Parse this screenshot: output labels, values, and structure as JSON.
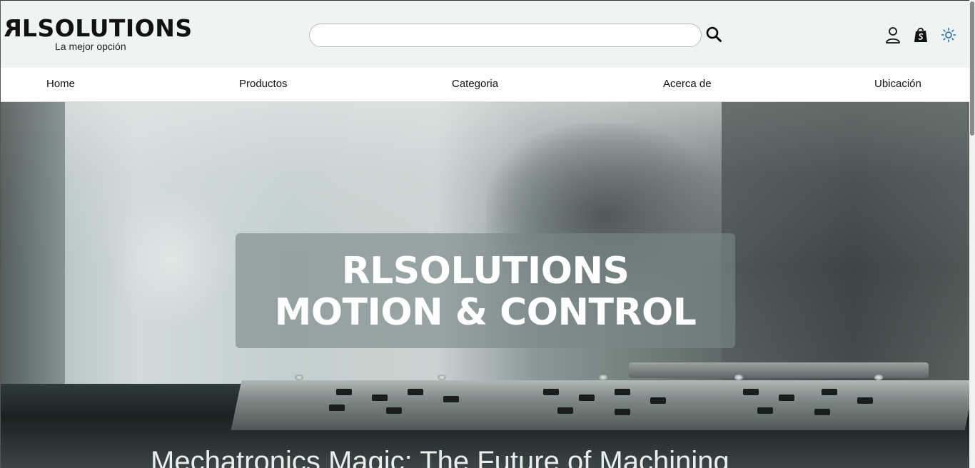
{
  "header": {
    "brand_mirrored_letter": "R",
    "brand_rest": "LSOLUTIONS",
    "tagline": "La mejor opción",
    "search": {
      "placeholder": "",
      "value": ""
    },
    "icons": {
      "search": "search-icon",
      "user": "user-icon",
      "shop": "shopping-bag-icon",
      "theme": "sun-icon"
    },
    "theme_icon_color": "#1a6aa8"
  },
  "nav": {
    "items": [
      {
        "label": "Home"
      },
      {
        "label": "Productos"
      },
      {
        "label": "Categoria"
      },
      {
        "label": "Acerca de"
      },
      {
        "label": "Ubicación"
      }
    ]
  },
  "hero": {
    "title_line1": "RLSOLUTIONS",
    "title_line2": "MOTION & CONTROL",
    "video_caption": "Mechatronics Magic: The Future of Machining"
  }
}
